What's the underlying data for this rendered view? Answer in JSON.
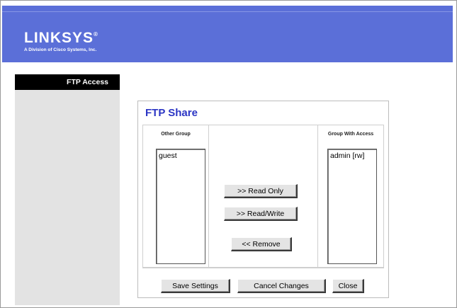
{
  "header": {
    "logo_text": "LINKSYS",
    "logo_mark": "®",
    "logo_subtitle": "A Division of Cisco Systems, Inc.",
    "brand_color": "#5b6fd8"
  },
  "sidebar": {
    "items": [
      {
        "label": "FTP Access",
        "active": true
      }
    ]
  },
  "panel": {
    "title": "FTP Share",
    "title_color": "#2b35c4",
    "other_group": {
      "label": "Other Group",
      "items": [
        "guest"
      ]
    },
    "group_with_access": {
      "label": "Group With Access",
      "items": [
        "admin [rw]"
      ]
    },
    "buttons": {
      "read_only": ">> Read Only",
      "read_write": ">> Read/Write",
      "remove": "<< Remove"
    },
    "footer": {
      "save": "Save Settings",
      "cancel": "Cancel Changes",
      "close": "Close"
    }
  }
}
